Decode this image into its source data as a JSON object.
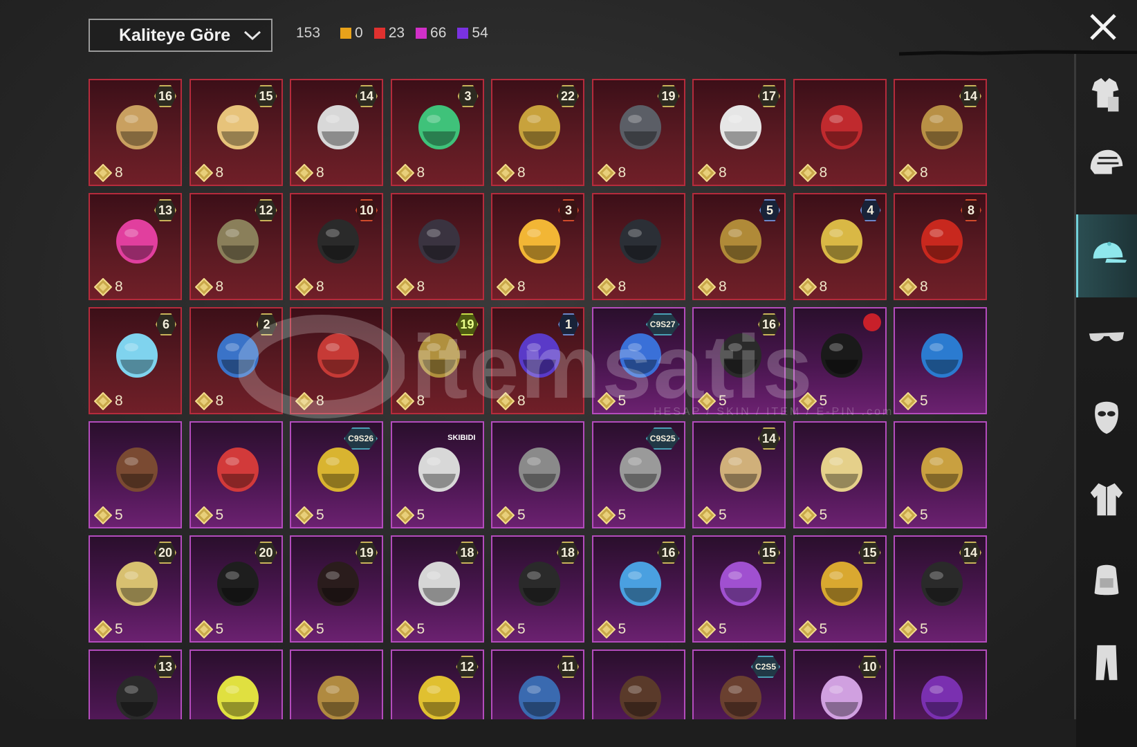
{
  "toolbar": {
    "sort_label": "Kaliteye Göre",
    "total": "153",
    "counts": [
      {
        "color": "#e8a21a",
        "value": "0"
      },
      {
        "color": "#e0312f",
        "value": "23"
      },
      {
        "color": "#d130c8",
        "value": "66"
      },
      {
        "color": "#7a32e0",
        "value": "54"
      }
    ]
  },
  "icons": {
    "close": "close-icon",
    "currency": "diamond-icon",
    "sidebar": [
      "outfit-icon",
      "helmet-icon",
      "cap-icon",
      "eyewear-icon",
      "mask-icon",
      "jacket-icon",
      "backpack-icon",
      "pants-icon"
    ]
  },
  "sidebar": {
    "active_index": 2
  },
  "watermark": {
    "text": "itemsatis",
    "sub": "HESAP / SKIN / ITEM / E-PIN .com"
  },
  "cards": [
    {
      "rarity": "legendary",
      "badge": "16",
      "cost": "8"
    },
    {
      "rarity": "legendary",
      "badge": "15",
      "cost": "8"
    },
    {
      "rarity": "legendary",
      "badge": "14",
      "cost": "8"
    },
    {
      "rarity": "legendary",
      "badge": "3",
      "cost": "8"
    },
    {
      "rarity": "legendary",
      "badge": "22",
      "cost": "8"
    },
    {
      "rarity": "legendary",
      "badge": "19",
      "cost": "8"
    },
    {
      "rarity": "legendary",
      "badge": "17",
      "cost": "8"
    },
    {
      "rarity": "legendary",
      "badge": "",
      "cost": "8"
    },
    {
      "rarity": "legendary",
      "badge": "14",
      "cost": "8"
    },
    {
      "rarity": "legendary",
      "badge": "13",
      "cost": "8"
    },
    {
      "rarity": "legendary",
      "badge": "12",
      "cost": "8"
    },
    {
      "rarity": "legendary",
      "badge": "10",
      "cost": "8"
    },
    {
      "rarity": "legendary",
      "badge": "",
      "cost": "8"
    },
    {
      "rarity": "legendary",
      "badge": "3",
      "cost": "8"
    },
    {
      "rarity": "legendary",
      "badge": "",
      "cost": "8"
    },
    {
      "rarity": "legendary",
      "badge": "5",
      "cost": "8"
    },
    {
      "rarity": "legendary",
      "badge": "4",
      "cost": "8"
    },
    {
      "rarity": "legendary",
      "badge": "8",
      "cost": "8"
    },
    {
      "rarity": "legendary",
      "badge": "6",
      "cost": "8"
    },
    {
      "rarity": "legendary",
      "badge": "2",
      "cost": "8"
    },
    {
      "rarity": "legendary",
      "badge": "",
      "cost": "8"
    },
    {
      "rarity": "legendary",
      "badge": "19",
      "cost": "8"
    },
    {
      "rarity": "legendary",
      "badge": "1",
      "cost": "8"
    },
    {
      "rarity": "epic",
      "badge": "C9S27",
      "cost": "5"
    },
    {
      "rarity": "epic",
      "badge": "16",
      "cost": "5"
    },
    {
      "rarity": "epic",
      "badge": "",
      "cost": "5"
    },
    {
      "rarity": "epic",
      "badge": "",
      "cost": "5"
    },
    {
      "rarity": "epic",
      "badge": "",
      "cost": "5"
    },
    {
      "rarity": "epic",
      "badge": "",
      "cost": "5"
    },
    {
      "rarity": "epic",
      "badge": "C9S26",
      "cost": "5"
    },
    {
      "rarity": "epic",
      "badge": "SKIBIDI",
      "cost": "5"
    },
    {
      "rarity": "epic",
      "badge": "",
      "cost": "5"
    },
    {
      "rarity": "epic",
      "badge": "C9S25",
      "cost": "5"
    },
    {
      "rarity": "epic",
      "badge": "14",
      "cost": "5"
    },
    {
      "rarity": "epic",
      "badge": "",
      "cost": "5"
    },
    {
      "rarity": "epic",
      "badge": "",
      "cost": "5"
    },
    {
      "rarity": "epic",
      "badge": "20",
      "cost": "5"
    },
    {
      "rarity": "epic",
      "badge": "20",
      "cost": "5"
    },
    {
      "rarity": "epic",
      "badge": "19",
      "cost": "5"
    },
    {
      "rarity": "epic",
      "badge": "18",
      "cost": "5"
    },
    {
      "rarity": "epic",
      "badge": "18",
      "cost": "5"
    },
    {
      "rarity": "epic",
      "badge": "16",
      "cost": "5"
    },
    {
      "rarity": "epic",
      "badge": "15",
      "cost": "5"
    },
    {
      "rarity": "epic",
      "badge": "15",
      "cost": "5"
    },
    {
      "rarity": "epic",
      "badge": "14",
      "cost": "5"
    },
    {
      "rarity": "epic",
      "badge": "13",
      "cost": ""
    },
    {
      "rarity": "epic",
      "badge": "",
      "cost": ""
    },
    {
      "rarity": "epic",
      "badge": "",
      "cost": ""
    },
    {
      "rarity": "epic",
      "badge": "12",
      "cost": ""
    },
    {
      "rarity": "epic",
      "badge": "11",
      "cost": ""
    },
    {
      "rarity": "epic",
      "badge": "",
      "cost": ""
    },
    {
      "rarity": "epic",
      "badge": "C2S5",
      "cost": ""
    },
    {
      "rarity": "epic",
      "badge": "10",
      "cost": ""
    },
    {
      "rarity": "epic",
      "badge": "",
      "cost": ""
    }
  ]
}
